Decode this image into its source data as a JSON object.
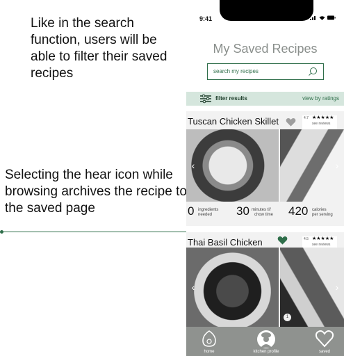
{
  "annotations": {
    "search_note": "Like in the search function, users will be able to filter their saved recipes",
    "heart_note": "Selecting the hear icon while browsing archives the recipe to the saved page"
  },
  "status_bar": {
    "time": "9:41",
    "icons": "signal-icon wifi-icon battery-icon"
  },
  "page_title": "My Saved Recipes",
  "search": {
    "placeholder": "search my recipes",
    "icon": "search-icon"
  },
  "filter_bar": {
    "filter_label": "filter results",
    "view_label": "view by ratings",
    "icon": "sliders-icon"
  },
  "recipes": [
    {
      "title": "Tuscan Chicken Skillet",
      "saved": false,
      "heart_color": "#9e9e9e",
      "rating": "4.7",
      "stars": "★★★★★",
      "reviews": "see reviews",
      "stats": [
        {
          "value": "0",
          "label_1": "ingredients",
          "label_2": "needed"
        },
        {
          "value": "30",
          "label_1": "minutes til'",
          "label_2": "chow time"
        },
        {
          "value": "420",
          "label_1": "calories",
          "label_2": "per serving"
        }
      ]
    },
    {
      "title": "Thai Basil Chicken",
      "saved": true,
      "heart_color": "#2f6e4a",
      "rating": "4.5",
      "stars": "★★★★★",
      "reviews": "see reviews",
      "photo_badge": "1"
    }
  ],
  "tab_bar": {
    "items": [
      {
        "label": "home",
        "icon": "egg-icon"
      },
      {
        "label": "kitchen profile",
        "icon": "chef-icon"
      },
      {
        "label": "saved",
        "icon": "heart-icon"
      }
    ]
  },
  "colors": {
    "accent": "#2f6e4a",
    "filter_bg": "#d5e6dd",
    "tab_bar": "#8f928f",
    "title_gray": "#8a8f8c"
  }
}
